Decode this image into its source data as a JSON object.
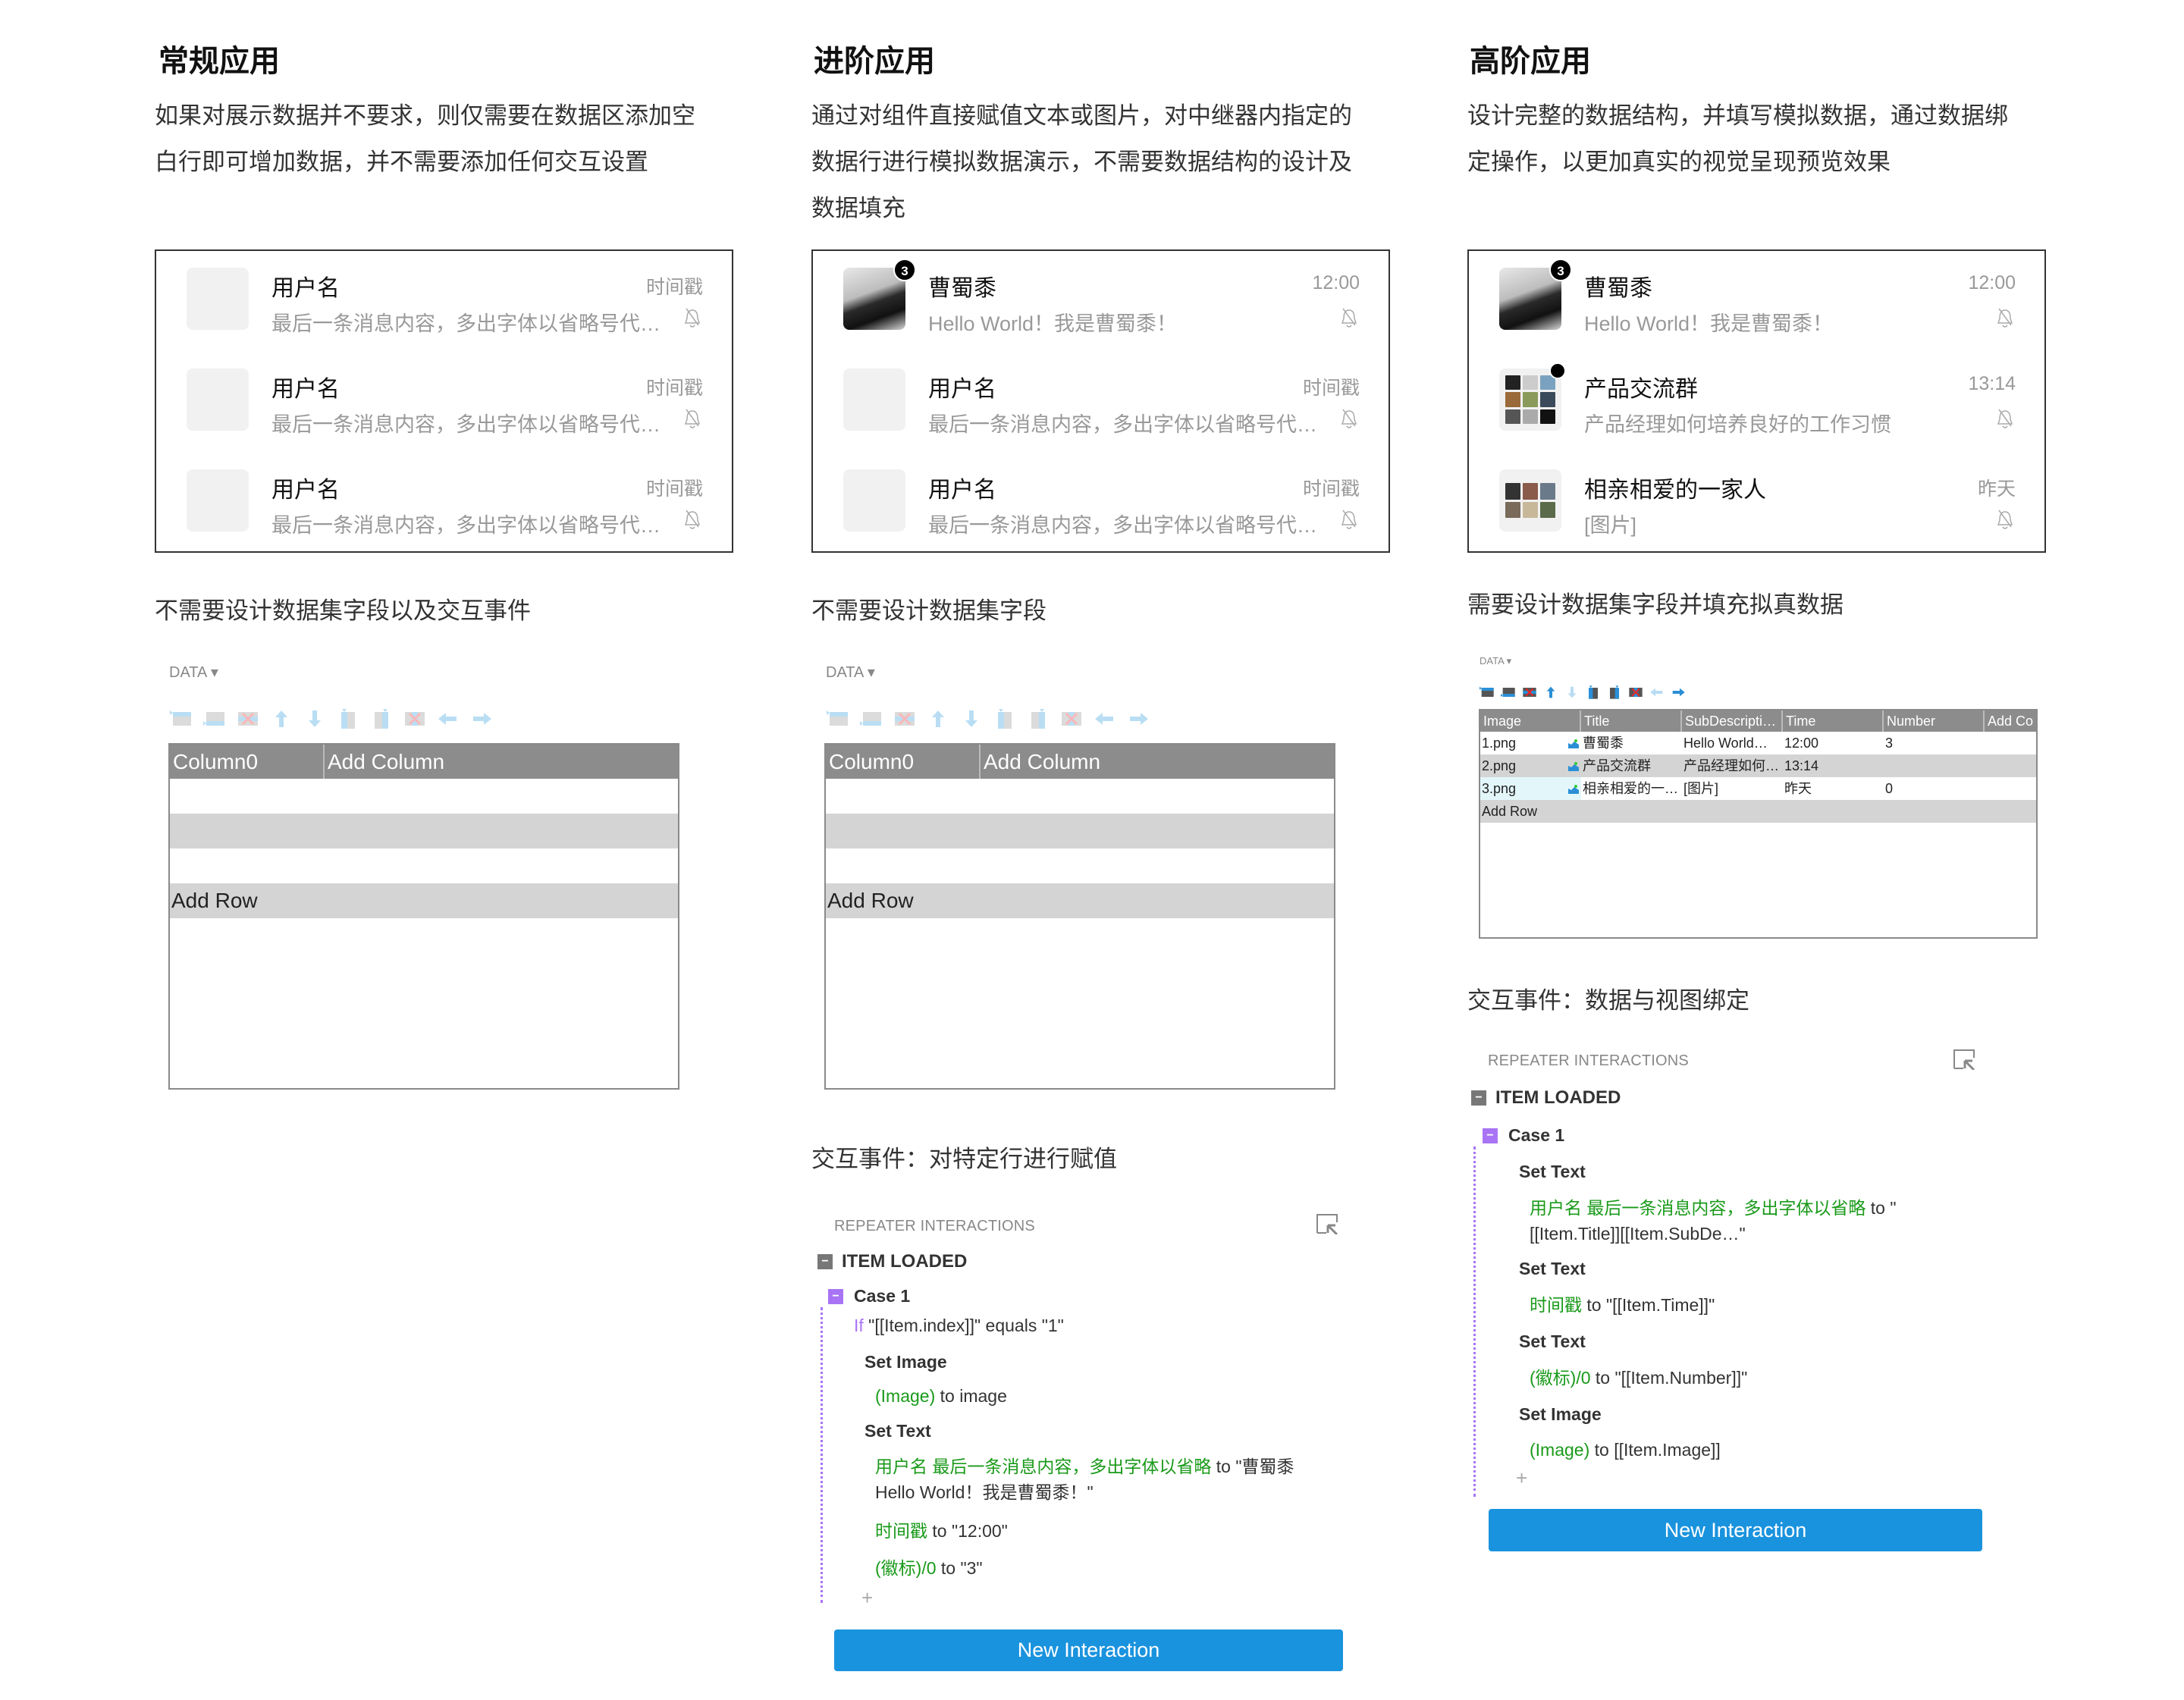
{
  "colors": {
    "accent_blue": "#1a93de",
    "case_purple": "#a874f5",
    "target_green": "#1a9a1a",
    "table_header": "#8c8c8c",
    "table_alt_row": "#d4d4d4"
  },
  "columns": [
    {
      "title": "常规应用",
      "description": [
        "如果对展示数据并不要求，则仅需要在数据区添加空",
        "白行即可增加数据，并不需要添加任何交互设置"
      ],
      "preview": [
        {
          "avatar": "placeholder",
          "name": "用户名",
          "time": "时间戳",
          "sub": "最后一条消息内容，多出字体以省略号代替…",
          "icon": "bell-muted-icon"
        },
        {
          "avatar": "placeholder",
          "name": "用户名",
          "time": "时间戳",
          "sub": "最后一条消息内容，多出字体以省略号代替…",
          "icon": "bell-muted-icon"
        },
        {
          "avatar": "placeholder",
          "name": "用户名",
          "time": "时间戳",
          "sub": "最后一条消息内容，多出字体以省略号代替…",
          "icon": "bell-muted-icon"
        }
      ],
      "subtitle": "不需要设计数据集字段以及交互事件",
      "data_panel": {
        "label": "DATA ▾",
        "headers": [
          "Column0",
          "Add Column"
        ],
        "rows": [
          [
            "",
            ""
          ],
          [
            "",
            ""
          ],
          [
            "",
            ""
          ]
        ],
        "add_row": "Add Row"
      }
    },
    {
      "title": "进阶应用",
      "description": [
        "通过对组件直接赋值文本或图片，对中继器内指定的",
        "数据行进行模拟数据演示，不需要数据结构的设计及",
        "数据填充"
      ],
      "preview": [
        {
          "avatar": "photo",
          "badge": "3",
          "name": "曹蜀黍",
          "time": "12:00",
          "sub": "Hello World！我是曹蜀黍！",
          "icon": "bell-muted-icon"
        },
        {
          "avatar": "placeholder",
          "name": "用户名",
          "time": "时间戳",
          "sub": "最后一条消息内容，多出字体以省略号代替…",
          "icon": "bell-muted-icon"
        },
        {
          "avatar": "placeholder",
          "name": "用户名",
          "time": "时间戳",
          "sub": "最后一条消息内容，多出字体以省略号代替…",
          "icon": "bell-muted-icon"
        }
      ],
      "subtitle": "不需要设计数据集字段",
      "data_panel": {
        "label": "DATA ▾",
        "headers": [
          "Column0",
          "Add Column"
        ],
        "rows": [
          [
            "",
            ""
          ],
          [
            "",
            ""
          ],
          [
            "",
            ""
          ]
        ],
        "add_row": "Add Row"
      },
      "interactions_heading": "交互事件：对特定行进行赋值",
      "interactions": {
        "panel_label": "REPEATER INTERACTIONS",
        "event": "ITEM LOADED",
        "case": "Case 1",
        "condition": {
          "kw": "If",
          "text": " \"[[Item.index]]\" equals \"1\""
        },
        "actions": [
          {
            "label": "Set Image",
            "lines": [
              {
                "target": "(Image)",
                "rest": " to image"
              }
            ]
          },
          {
            "label": "Set Text",
            "lines": [
              {
                "target": "用户名 最后一条消息内容，多出字体以省略",
                "rest": " to \"曹蜀黍 Hello World！我是曹蜀黍！\""
              },
              {
                "target": "时间戳",
                "rest": " to \"12:00\""
              },
              {
                "target": "(徽标)/0",
                "rest": " to \"3\""
              }
            ]
          }
        ],
        "plus": "+",
        "button": "New Interaction"
      }
    },
    {
      "title": "高阶应用",
      "description": [
        "设计完整的数据结构，并填写模拟数据，通过数据绑",
        "定操作，以更加真实的视觉呈现预览效果"
      ],
      "preview": [
        {
          "avatar": "photo",
          "badge": "3",
          "name": "曹蜀黍",
          "time": "12:00",
          "sub": "Hello World！我是曹蜀黍！",
          "icon": "bell-muted-icon"
        },
        {
          "avatar": "grid9",
          "dot": true,
          "name": "产品交流群",
          "time": "13:14",
          "sub": "产品经理如何培养良好的工作习惯",
          "icon": "bell-muted-icon"
        },
        {
          "avatar": "grid6",
          "name": "相亲相爱的一家人",
          "time": "昨天",
          "sub": "[图片]",
          "icon": "bell-muted-icon"
        }
      ],
      "subtitle": "需要设计数据集字段并填充拟真数据",
      "data_panel": {
        "label": "DATA ▾",
        "headers": [
          "Image",
          "Title",
          "SubDescripti…",
          "Time",
          "Number",
          "Add Co"
        ],
        "rows": [
          [
            "1.png",
            "曹蜀黍",
            "Hello World…",
            "12:00",
            "3",
            ""
          ],
          [
            "2.png",
            "产品交流群",
            "产品经理如何…",
            "13:14",
            "",
            ""
          ],
          [
            "3.png",
            "相亲相爱的一…",
            "[图片]",
            "昨天",
            "0",
            ""
          ]
        ],
        "add_row": "Add Row"
      },
      "interactions_heading": "交互事件：数据与视图绑定",
      "interactions": {
        "panel_label": "REPEATER INTERACTIONS",
        "event": "ITEM LOADED",
        "case": "Case 1",
        "actions": [
          {
            "label": "Set Text",
            "lines": [
              {
                "target": "用户名 最后一条消息内容，多出字体以省略",
                "rest": " to \"[[Item.Title]][[Item.SubDe…\""
              }
            ]
          },
          {
            "label": "Set Text",
            "lines": [
              {
                "target": "时间戳",
                "rest": " to \"[[Item.Time]]\""
              }
            ]
          },
          {
            "label": "Set Text",
            "lines": [
              {
                "target": "(徽标)/0",
                "rest": " to \"[[Item.Number]]\""
              }
            ]
          },
          {
            "label": "Set Image",
            "lines": [
              {
                "target": "(Image)",
                "rest": " to [[Item.Image]]"
              }
            ]
          }
        ],
        "plus": "+",
        "button": "New Interaction"
      }
    }
  ]
}
